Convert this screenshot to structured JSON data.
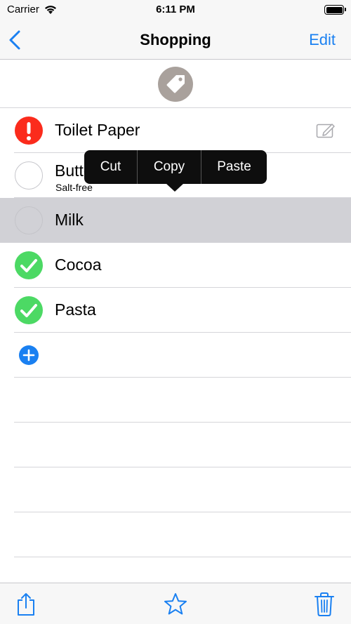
{
  "status_bar": {
    "carrier": "Carrier",
    "time": "6:11 PM",
    "battery_level": 1.0
  },
  "nav": {
    "back_icon": "chevron-left-icon",
    "title": "Shopping",
    "edit_label": "Edit"
  },
  "tag": {
    "icon": "tag-icon",
    "color": "#a9a19c"
  },
  "items": [
    {
      "name": "Toilet Paper",
      "status": "urgent",
      "note": "",
      "has_note_icon": true
    },
    {
      "name": "Butter",
      "status": "open",
      "note": "Salt-free"
    },
    {
      "name": "Milk",
      "status": "open",
      "selected": true
    },
    {
      "name": "Cocoa",
      "status": "done"
    },
    {
      "name": "Pasta",
      "status": "done"
    }
  ],
  "context_menu": {
    "cut": "Cut",
    "copy": "Copy",
    "paste": "Paste"
  },
  "toolbar": {
    "share_icon": "share-icon",
    "favorite_icon": "star-icon",
    "delete_icon": "trash-icon"
  },
  "colors": {
    "accent": "#1a80f1",
    "urgent": "#fb2b1c",
    "done": "#4cd964",
    "selected_row": "#d1d1d6"
  }
}
